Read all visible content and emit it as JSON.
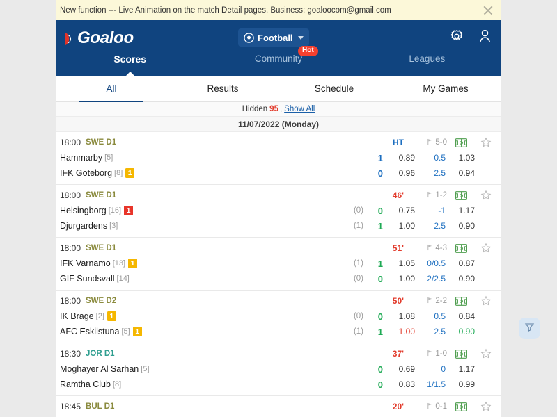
{
  "notice": {
    "text": "New function --- Live Animation on the match Detail pages. Business: goaloocom@gmail.com",
    "close_icon": "close-icon"
  },
  "header": {
    "logo_text": "Goaloo",
    "sport": {
      "label": "Football",
      "icon": "football-icon",
      "caret": "chevron-down-icon"
    },
    "settings_icon": "gear-icon",
    "account_icon": "user-icon",
    "nav": [
      {
        "label": "Scores",
        "active": true,
        "badge": ""
      },
      {
        "label": "Community",
        "active": false,
        "badge": "Hot"
      },
      {
        "label": "Leagues",
        "active": false,
        "badge": ""
      }
    ]
  },
  "subtabs": [
    {
      "label": "All",
      "active": true
    },
    {
      "label": "Results",
      "active": false
    },
    {
      "label": "Schedule",
      "active": false
    },
    {
      "label": "My Games",
      "active": false
    }
  ],
  "hidden_bar": {
    "label": "Hidden",
    "count": "95",
    "separator": ",",
    "show_all": "Show All"
  },
  "date_bar": {
    "label": "11/07/2022 (Monday)"
  },
  "matches": [
    {
      "time": "18:00",
      "league": "SWE D1",
      "league_color": "#8a8a3d",
      "status": "HT",
      "status_kind": "ht",
      "ht_score": "5-0",
      "pitch_icon": "pitch-icon",
      "star_icon": "star-icon",
      "home": {
        "name": "Hammarby",
        "rank": "[5]",
        "card": "",
        "card_kind": "",
        "corners": "",
        "score": "1",
        "score_kind": "blue",
        "odd": "0.89",
        "odd_kind": "",
        "handicap": "0.5",
        "odd_last": "1.03",
        "odd_last_kind": ""
      },
      "away": {
        "name": "IFK Goteborg",
        "rank": "[8]",
        "card": "1",
        "card_kind": "yellow",
        "corners": "",
        "score": "0",
        "score_kind": "blue",
        "odd": "0.96",
        "odd_kind": "",
        "handicap": "2.5",
        "odd_last": "0.94",
        "odd_last_kind": ""
      }
    },
    {
      "time": "18:00",
      "league": "SWE D1",
      "league_color": "#8a8a3d",
      "status": "46'",
      "status_kind": "live",
      "ht_score": "1-2",
      "pitch_icon": "pitch-icon",
      "star_icon": "star-icon",
      "home": {
        "name": "Helsingborg",
        "rank": "[16]",
        "card": "1",
        "card_kind": "red",
        "corners": "(0)",
        "score": "0",
        "score_kind": "green",
        "odd": "0.75",
        "odd_kind": "",
        "handicap": "-1",
        "odd_last": "1.17",
        "odd_last_kind": ""
      },
      "away": {
        "name": "Djurgardens",
        "rank": "[3]",
        "card": "",
        "card_kind": "",
        "corners": "(1)",
        "score": "1",
        "score_kind": "green",
        "odd": "1.00",
        "odd_kind": "",
        "handicap": "2.5",
        "odd_last": "0.90",
        "odd_last_kind": ""
      }
    },
    {
      "time": "18:00",
      "league": "SWE D1",
      "league_color": "#8a8a3d",
      "status": "51'",
      "status_kind": "live",
      "ht_score": "4-3",
      "pitch_icon": "pitch-icon",
      "star_icon": "star-icon",
      "home": {
        "name": "IFK Varnamo",
        "rank": "[13]",
        "card": "1",
        "card_kind": "yellow",
        "corners": "(1)",
        "score": "1",
        "score_kind": "green",
        "odd": "1.05",
        "odd_kind": "",
        "handicap": "0/0.5",
        "odd_last": "0.87",
        "odd_last_kind": ""
      },
      "away": {
        "name": "GIF Sundsvall",
        "rank": "[14]",
        "card": "",
        "card_kind": "",
        "corners": "(0)",
        "score": "0",
        "score_kind": "green",
        "odd": "1.00",
        "odd_kind": "",
        "handicap": "2/2.5",
        "odd_last": "0.90",
        "odd_last_kind": ""
      }
    },
    {
      "time": "18:00",
      "league": "SWE D2",
      "league_color": "#8a8a3d",
      "status": "50'",
      "status_kind": "live",
      "ht_score": "2-2",
      "pitch_icon": "pitch-icon",
      "star_icon": "star-icon",
      "home": {
        "name": "IK Brage",
        "rank": "[2]",
        "card": "1",
        "card_kind": "yellow",
        "corners": "(0)",
        "score": "0",
        "score_kind": "green",
        "odd": "1.08",
        "odd_kind": "",
        "handicap": "0.5",
        "odd_last": "0.84",
        "odd_last_kind": ""
      },
      "away": {
        "name": "AFC Eskilstuna",
        "rank": "[5]",
        "card": "1",
        "card_kind": "yellow",
        "corners": "(1)",
        "score": "1",
        "score_kind": "green",
        "odd": "1.00",
        "odd_kind": "red",
        "handicap": "2.5",
        "odd_last": "0.90",
        "odd_last_kind": "green"
      }
    },
    {
      "time": "18:30",
      "league": "JOR D1",
      "league_color": "#2f9e8f",
      "status": "37'",
      "status_kind": "live",
      "ht_score": "1-0",
      "pitch_icon": "pitch-icon",
      "star_icon": "star-icon",
      "home": {
        "name": "Moghayer Al Sarhan",
        "rank": "[5]",
        "card": "",
        "card_kind": "",
        "corners": "",
        "score": "0",
        "score_kind": "green",
        "odd": "0.69",
        "odd_kind": "",
        "handicap": "0",
        "odd_last": "1.17",
        "odd_last_kind": ""
      },
      "away": {
        "name": "Ramtha Club",
        "rank": "[8]",
        "card": "",
        "card_kind": "",
        "corners": "",
        "score": "0",
        "score_kind": "green",
        "odd": "0.83",
        "odd_kind": "",
        "handicap": "1/1.5",
        "odd_last": "0.99",
        "odd_last_kind": ""
      }
    },
    {
      "time": "18:45",
      "league": "BUL D1",
      "league_color": "#8a8a3d",
      "status": "20'",
      "status_kind": "live",
      "ht_score": "0-1",
      "pitch_icon": "pitch-icon",
      "star_icon": "star-icon",
      "home": null,
      "away": null
    }
  ],
  "filter_fab": {
    "icon": "filter-icon"
  }
}
